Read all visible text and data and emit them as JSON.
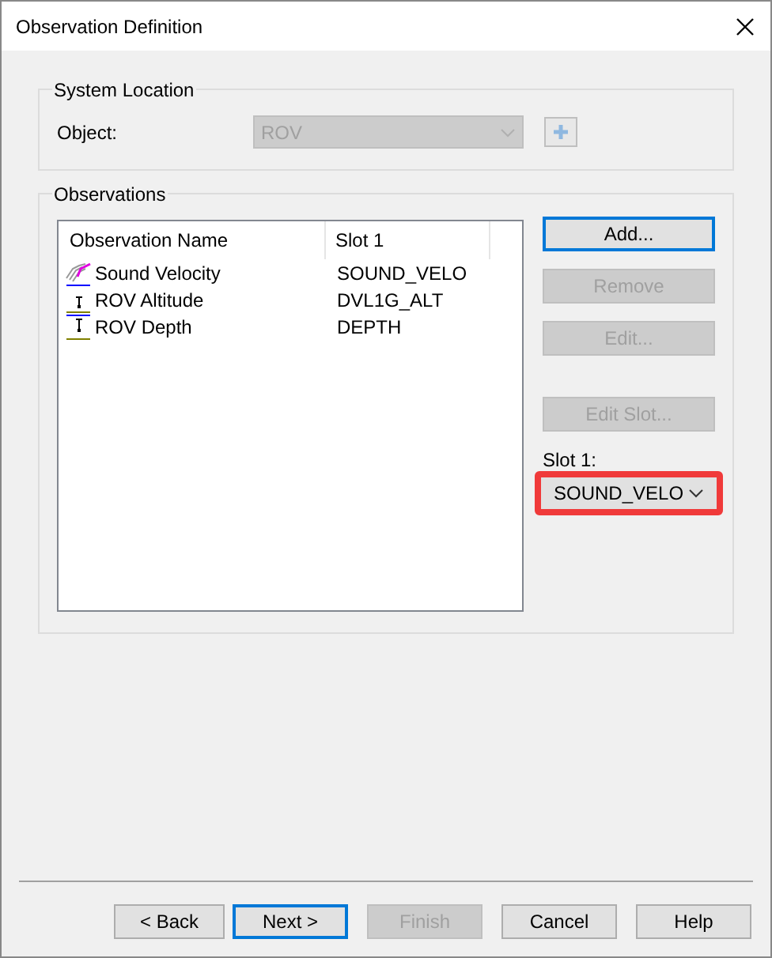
{
  "window": {
    "title": "Observation Definition"
  },
  "system_location": {
    "title": "System Location",
    "object_label": "Object:",
    "object_value": "ROV",
    "object_disabled": true,
    "add_disabled": true
  },
  "observations": {
    "title": "Observations",
    "columns": [
      "Observation Name",
      "Slot 1"
    ],
    "rows": [
      {
        "kind": "sound_velocity",
        "name": "Sound Velocity",
        "slot_1": "SOUND_VELO"
      },
      {
        "kind": "altitude",
        "name": "ROV Altitude",
        "slot_1": "DVL1G_ALT"
      },
      {
        "kind": "depth",
        "name": "ROV Depth",
        "slot_1": "DEPTH"
      }
    ],
    "buttons": [
      {
        "label": "Add...",
        "disabled": false,
        "default": true
      },
      {
        "label": "Remove",
        "disabled": true,
        "default": false
      },
      {
        "label": "Edit...",
        "disabled": true,
        "default": false
      },
      {
        "label": "Edit Slot...",
        "disabled": true,
        "default": false
      }
    ],
    "slot_label": "Slot 1:",
    "slot_value": "SOUND_VELO",
    "slot_highlighted": true
  },
  "footer_buttons": [
    {
      "label": "< Back",
      "disabled": false,
      "default": false
    },
    {
      "label": "Next >",
      "disabled": false,
      "default": true
    },
    {
      "label": "Finish",
      "disabled": true,
      "default": false
    },
    {
      "label": "Cancel",
      "disabled": false,
      "default": false
    },
    {
      "label": "Help",
      "disabled": false,
      "default": false
    }
  ]
}
